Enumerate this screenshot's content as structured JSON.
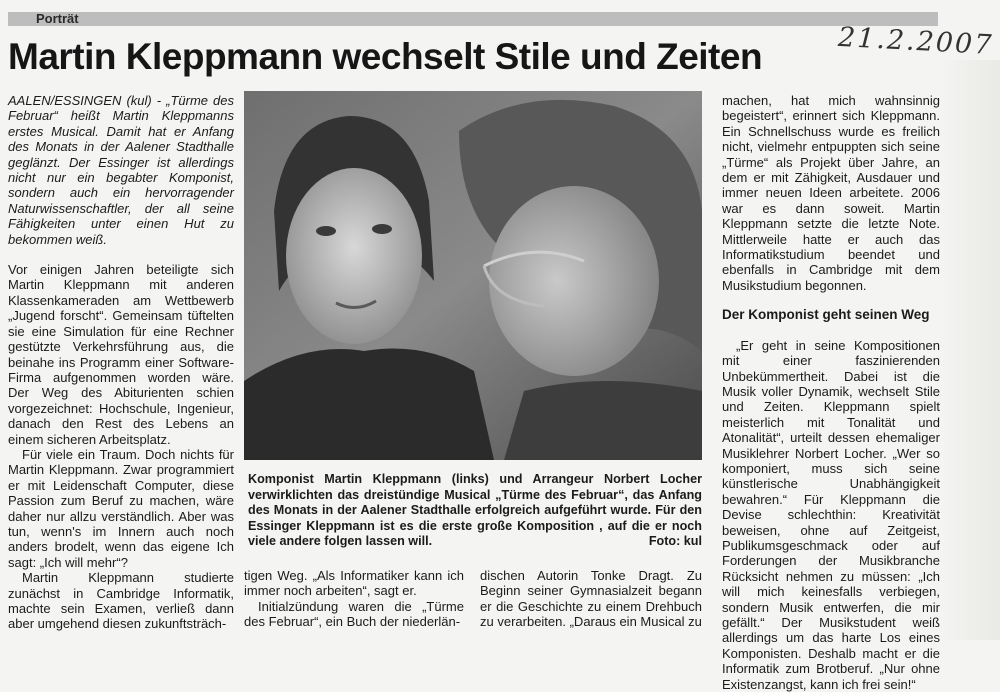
{
  "rubric": "Porträt",
  "handwritten_date": "21.2.2007",
  "headline": "Martin Kleppmann wechselt Stile und Zeiten",
  "intro": "AALEN/ESSINGEN (kul) - „Türme des Februar“ heißt Martin Kleppmanns erstes Musical. Damit hat er Anfang des Monats in der Aalener Stadthalle geglänzt. Der Essinger ist allerdings nicht nur ein begabter Komponist, sondern auch ein hervorragender Naturwissenschaftler, der all seine Fähigkeiten unter einen Hut zu bekommen weiß.",
  "col1": {
    "p1": "Vor einigen Jahren beteiligte sich Martin Kleppmann mit anderen Klassenkameraden am Wettbewerb „Jugend forscht“. Gemeinsam tüftelten sie eine Simulation für eine Rechner gestützte Verkehrsführung aus, die beinahe ins Programm einer Software-Firma aufgenommen worden wäre. Der Weg des Abiturienten schien vorgezeichnet: Hochschule, Ingenieur, danach den Rest des Lebens an einem sicheren Arbeitsplatz.",
    "p2": "Für viele ein Traum. Doch nichts für Martin Kleppmann. Zwar programmiert er mit Leidenschaft Computer, diese Passion zum Beruf zu machen, wäre daher nur allzu verständlich. Aber was tun, wenn's im Innern auch noch anders brodelt, wenn das eigene Ich sagt: „Ich will mehr“?",
    "p3": "Martin Kleppmann studierte zunächst in Cambridge Informatik, machte sein Examen, verließ dann aber umgehend diesen zukunftsträch-"
  },
  "col2": {
    "p1": "tigen Weg. „Als Informatiker kann ich immer noch arbeiten“, sagt er.",
    "p2": "Initialzündung waren die „Türme des Februar“, ein Buch der niederlän-"
  },
  "col3": {
    "p1": "dischen Autorin Tonke Dragt. Zu Beginn seiner Gymnasialzeit begann er die Geschichte zu einem Drehbuch zu verarbeiten. „Daraus ein Musical zu"
  },
  "caption": {
    "text": "Komponist Martin Kleppmann (links) und Arrangeur Norbert Locher verwirklichten das dreistündige Musical „Türme des Februar“, das Anfang des Monats in der Aalener Stadthalle erfolgreich aufgeführt wurde. Für den Essinger Kleppmann ist es die erste große Komposition , auf die er noch viele andere folgen lassen will.",
    "credit": "Foto: kul"
  },
  "col4": {
    "p1": "machen, hat mich wahnsinnig begeistert“, erinnert sich Kleppmann. Ein Schnellschuss wurde es freilich nicht, vielmehr entpuppten sich seine „Türme“ als Projekt über Jahre, an dem er mit Zähigkeit, Ausdauer und immer neuen Ideen arbeitete. 2006 war es dann soweit. Martin Kleppmann setzte die letzte Note. Mittlerweile hatte er auch das Informatikstudium beendet und ebenfalls in Cambridge mit dem Musikstudium begonnen.",
    "subhead": "Der Komponist geht seinen Weg",
    "p2": "„Er geht in seine Kompositionen mit einer faszinierenden Unbekümmertheit. Dabei ist die Musik voller Dynamik, wechselt Stile und Zeiten. Kleppmann spielt meisterlich mit Tonalität und Atonalität“, urteilt dessen ehemaliger Musiklehrer Norbert Locher. „Wer so komponiert, muss sich seine künstlerische Unabhängigkeit bewahren.“ Für Kleppmann die Devise schlechthin: Kreativität beweisen, ohne auf Zeitgeist, Publikumsgeschmack oder auf Forderungen der Musikbranche Rücksicht nehmen zu müssen: „Ich will mich keinesfalls verbiegen, sondern Musik entwerfen, die mir gefällt.“ Der Musikstudent weiß allerdings um das harte Los eines Komponisten. Deshalb macht er die Informatik zum Brotberuf. „Nur ohne Existenzangst, kann ich frei sein!“"
  }
}
